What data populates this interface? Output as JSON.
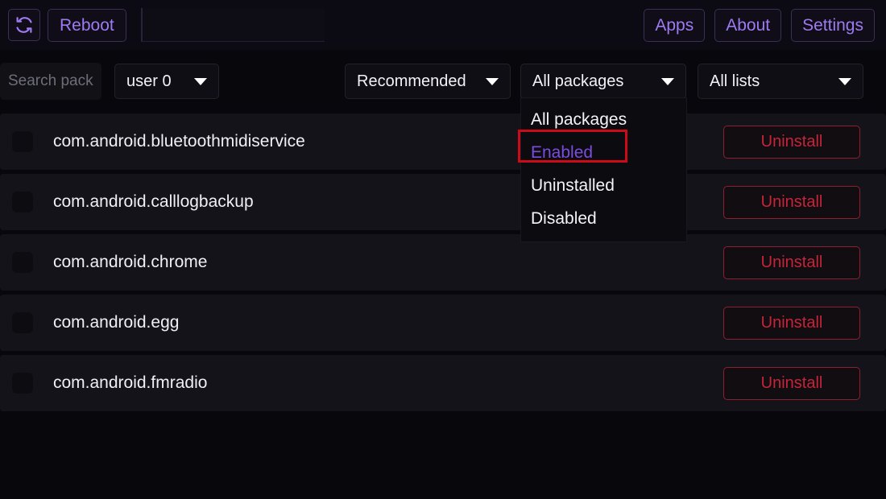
{
  "topbar": {
    "refresh_icon": "refresh-sync-icon",
    "reboot_label": "Reboot",
    "text_input_value": "",
    "text_input_placeholder": "",
    "apps_label": "Apps",
    "about_label": "About",
    "settings_label": "Settings"
  },
  "filterbar": {
    "search_placeholder": "Search pack",
    "search_value": "",
    "user_select": {
      "value": "user 0",
      "caret_icon": "chevron-down-icon"
    },
    "sort_select": {
      "value": "Recommended",
      "caret_icon": "chevron-down-icon"
    },
    "state_select": {
      "value": "All packages",
      "caret_icon": "chevron-down-icon"
    },
    "lists_select": {
      "value": "All lists",
      "caret_icon": "chevron-down-icon"
    }
  },
  "dropdown": {
    "open": true,
    "items": [
      {
        "label": "All packages",
        "highlighted": false
      },
      {
        "label": "Enabled",
        "highlighted": true
      },
      {
        "label": "Uninstalled",
        "highlighted": false
      },
      {
        "label": "Disabled",
        "highlighted": false
      }
    ],
    "highlight_border_color": "#cc0a18",
    "highlight_text_color": "#7c4ddd"
  },
  "packages": [
    {
      "name": "com.android.bluetoothmidiservice",
      "checked": false,
      "action_label": "Uninstall"
    },
    {
      "name": "com.android.calllogbackup",
      "checked": false,
      "action_label": "Uninstall"
    },
    {
      "name": "com.android.chrome",
      "checked": false,
      "action_label": "Uninstall"
    },
    {
      "name": "com.android.egg",
      "checked": false,
      "action_label": "Uninstall"
    },
    {
      "name": "com.android.fmradio",
      "checked": false,
      "action_label": "Uninstall"
    }
  ],
  "colors": {
    "background": "#08080c",
    "topbar": "#0c0a12",
    "accent_purple": "#9d7bf0",
    "danger_red": "#c6243a",
    "row_background": "#131319"
  }
}
